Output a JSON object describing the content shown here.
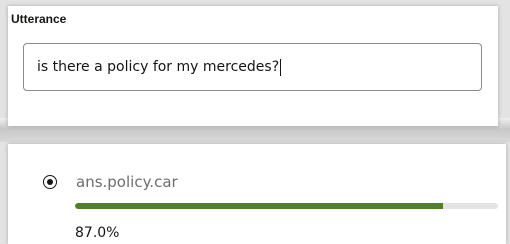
{
  "utterance": {
    "label": "Utterance",
    "value": "is there a policy for my mercedes?"
  },
  "results": [
    {
      "intent": "ans.policy.car",
      "confidence_text": "87.0%",
      "confidence": 0.87,
      "selected": true
    }
  ],
  "colors": {
    "bar_fill": "#508125",
    "bar_track": "#e4e4e4"
  }
}
